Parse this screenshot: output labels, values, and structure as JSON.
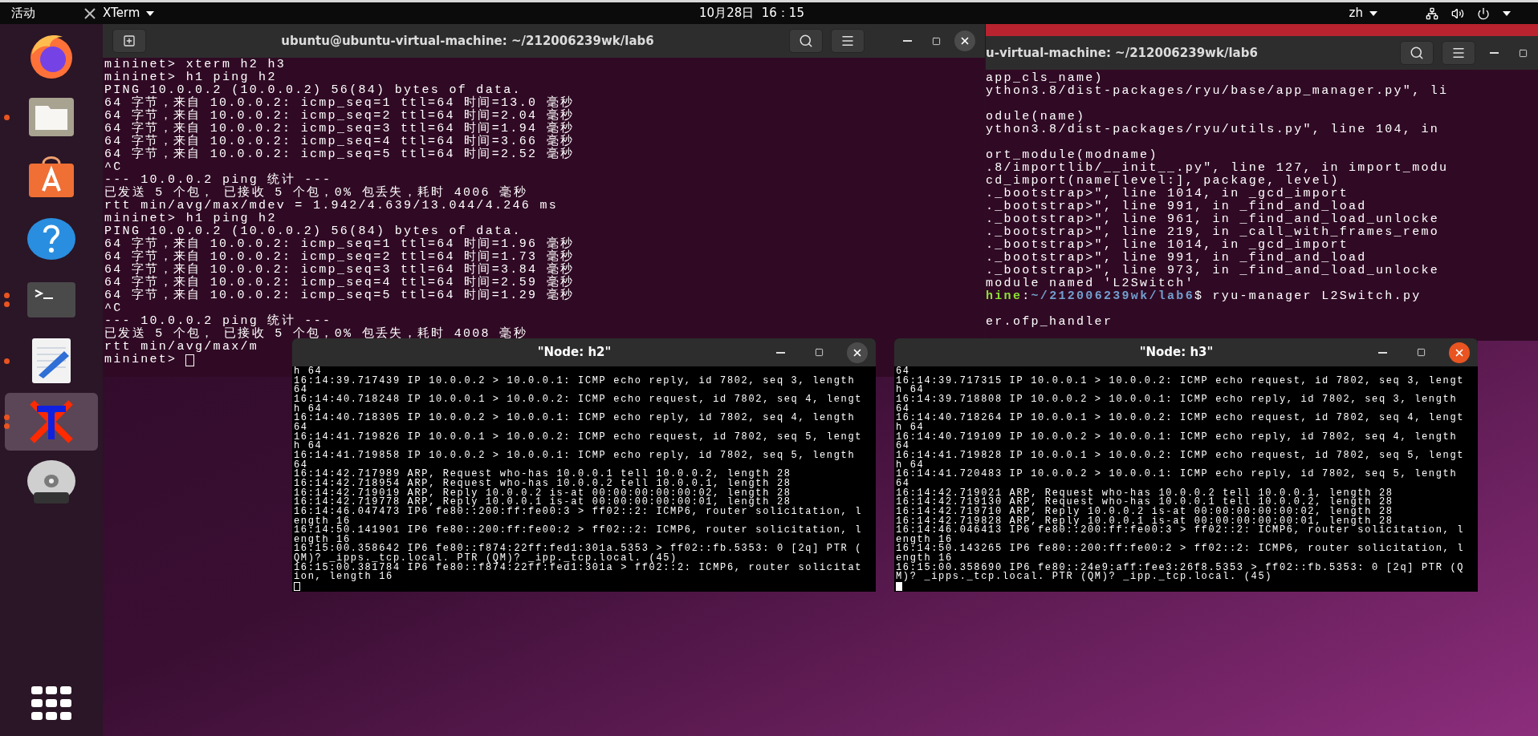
{
  "top_bar": {
    "activities": "活动",
    "app_menu": "XTerm",
    "clock": "10月28日  16：15",
    "language": "zh"
  },
  "dock": {
    "items": [
      {
        "kind": "browser",
        "selected": false,
        "running": false
      },
      {
        "kind": "files",
        "selected": false,
        "running": true,
        "multiple": false
      },
      {
        "kind": "software",
        "selected": false,
        "running": false
      },
      {
        "kind": "help",
        "selected": false,
        "running": false
      },
      {
        "kind": "terminal",
        "selected": false,
        "running": true,
        "multiple": true
      },
      {
        "kind": "editor",
        "selected": false,
        "running": true,
        "multiple": false
      },
      {
        "kind": "xterm",
        "selected": true,
        "running": true,
        "multiple": true
      },
      {
        "kind": "dvd",
        "selected": false,
        "running": false
      }
    ]
  },
  "main_terminal": {
    "title": "ubuntu@ubuntu-virtual-machine: ~/212006239wk/lab6",
    "focused": false,
    "lines": [
      "mininet> xterm h2 h3",
      "mininet> h1 ping h2",
      "PING 10.0.0.2 (10.0.0.2) 56(84) bytes of data.",
      "64 字节，来自 10.0.0.2: icmp_seq=1 ttl=64 时间=13.0 毫秒",
      "64 字节，来自 10.0.0.2: icmp_seq=2 ttl=64 时间=2.04 毫秒",
      "64 字节，来自 10.0.0.2: icmp_seq=3 ttl=64 时间=1.94 毫秒",
      "64 字节，来自 10.0.0.2: icmp_seq=4 ttl=64 时间=3.66 毫秒",
      "64 字节，来自 10.0.0.2: icmp_seq=5 ttl=64 时间=2.52 毫秒",
      "^C",
      "--- 10.0.0.2 ping 统计 ---",
      "已发送 5 个包， 已接收 5 个包，0% 包丢失，耗时 4006 毫秒",
      "rtt min/avg/max/mdev = 1.942/4.639/13.044/4.246 ms",
      "mininet> h1 ping h2",
      "PING 10.0.0.2 (10.0.0.2) 56(84) bytes of data.",
      "64 字节，来自 10.0.0.2: icmp_seq=1 ttl=64 时间=1.96 毫秒",
      "64 字节，来自 10.0.0.2: icmp_seq=2 ttl=64 时间=1.73 毫秒",
      "64 字节，来自 10.0.0.2: icmp_seq=3 ttl=64 时间=3.84 毫秒",
      "64 字节，来自 10.0.0.2: icmp_seq=4 ttl=64 时间=2.59 毫秒",
      "64 字节，来自 10.0.0.2: icmp_seq=5 ttl=64 时间=1.29 毫秒",
      "^C",
      "--- 10.0.0.2 ping 统计 ---",
      "已发送 5 个包， 已接收 5 个包，0% 包丢失，耗时 4008 毫秒",
      "rtt min/avg/max/m"
    ],
    "prompt": "mininet>"
  },
  "background_terminal": {
    "title": "u-virtual-machine: ~/212006239wk/lab6",
    "blocks": [
      {
        "lines": [
          "app_cls_name)",
          "ython3.8/dist-packages/ryu/base/app_manager.py\", li"
        ]
      },
      {
        "lines": [
          "odule(name)",
          "ython3.8/dist-packages/ryu/utils.py\", line 104, in"
        ]
      },
      {
        "lines": [
          "ort_module(modname)",
          ".8/importlib/__init__.py\", line 127, in import_modu",
          "cd_import(name[level:], package, level)",
          "._bootstrap>\", line 1014, in _gcd_import",
          "._bootstrap>\", line 991, in _find_and_load",
          "._bootstrap>\", line 961, in _find_and_load_unlocke",
          "._bootstrap>\", line 219, in _call_with_frames_remo",
          "._bootstrap>\", line 1014, in _gcd_import",
          "._bootstrap>\", line 991, in _find_and_load",
          "._bootstrap>\", line 973, in _find_and_load_unlocke",
          "module named 'L2Switch'"
        ],
        "prompt": {
          "host": "hine",
          "separator": ":",
          "path": "~/212006239wk/lab6",
          "command": "$ ryu-manager L2Switch.py"
        }
      },
      {
        "lines": [
          "er.ofp_handler"
        ]
      }
    ]
  },
  "nodes": [
    {
      "title": "\"Node: h2\"",
      "focused": false,
      "lines": [
        "h 64",
        "16:14:39.717439 IP 10.0.0.2 > 10.0.0.1: ICMP echo reply, id 7802, seq 3, length",
        "64",
        "16:14:40.718248 IP 10.0.0.1 > 10.0.0.2: ICMP echo request, id 7802, seq 4, lengt",
        "h 64",
        "16:14:40.718305 IP 10.0.0.2 > 10.0.0.1: ICMP echo reply, id 7802, seq 4, length",
        "64",
        "16:14:41.719826 IP 10.0.0.1 > 10.0.0.2: ICMP echo request, id 7802, seq 5, lengt",
        "h 64",
        "16:14:41.719858 IP 10.0.0.2 > 10.0.0.1: ICMP echo reply, id 7802, seq 5, length",
        "64",
        "16:14:42.717989 ARP, Request who-has 10.0.0.1 tell 10.0.0.2, length 28",
        "16:14:42.718954 ARP, Request who-has 10.0.0.2 tell 10.0.0.1, length 28",
        "16:14:42.719019 ARP, Reply 10.0.0.2 is-at 00:00:00:00:00:02, length 28",
        "16:14:42.719778 ARP, Reply 10.0.0.1 is-at 00:00:00:00:00:01, length 28",
        "16:14:46.047473 IP6 fe80::200:ff:fe00:3 > ff02::2: ICMP6, router solicitation, l",
        "ength 16",
        "16:14:50.141901 IP6 fe80::200:ff:fe00:2 > ff02::2: ICMP6, router solicitation, l",
        "ength 16",
        "16:15:00.358642 IP6 fe80::f874:22ff:fed1:301a.5353 > ff02::fb.5353: 0 [2q] PTR (",
        "QM)? _ipps._tcp.local. PTR (QM)? _ipp._tcp.local. (45)",
        "16:15:00.381784 IP6 fe80::f874:22ff:fed1:301a > ff02::2: ICMP6, router solicitat",
        "ion, length 16"
      ]
    },
    {
      "title": "\"Node: h3\"",
      "focused": true,
      "lines": [
        "64",
        "16:14:39.717315 IP 10.0.0.1 > 10.0.0.2: ICMP echo request, id 7802, seq 3, lengt",
        "h 64",
        "16:14:39.718808 IP 10.0.0.2 > 10.0.0.1: ICMP echo reply, id 7802, seq 3, length",
        "64",
        "16:14:40.718264 IP 10.0.0.1 > 10.0.0.2: ICMP echo request, id 7802, seq 4, lengt",
        "h 64",
        "16:14:40.719109 IP 10.0.0.2 > 10.0.0.1: ICMP echo reply, id 7802, seq 4, length",
        "64",
        "16:14:41.719828 IP 10.0.0.1 > 10.0.0.2: ICMP echo request, id 7802, seq 5, lengt",
        "h 64",
        "16:14:41.720483 IP 10.0.0.2 > 10.0.0.1: ICMP echo reply, id 7802, seq 5, length",
        "64",
        "16:14:42.719021 ARP, Request who-has 10.0.0.2 tell 10.0.0.1, length 28",
        "16:14:42.719130 ARP, Request who-has 10.0.0.1 tell 10.0.0.2, length 28",
        "16:14:42.719710 ARP, Reply 10.0.0.2 is-at 00:00:00:00:00:02, length 28",
        "16:14:42.719828 ARP, Reply 10.0.0.1 is-at 00:00:00:00:00:01, length 28",
        "16:14:46.046413 IP6 fe80::200:ff:fe00:3 > ff02::2: ICMP6, router solicitation, l",
        "ength 16",
        "16:14:50.143265 IP6 fe80::200:ff:fe00:2 > ff02::2: ICMP6, router solicitation, l",
        "ength 16",
        "16:15:00.358690 IP6 fe80::24e9:aff:fee3:26f8.5353 > ff02::fb.5353: 0 [2q] PTR (Q",
        "M)? _ipps._tcp.local. PTR (QM)? _ipp._tcp.local. (45)"
      ]
    }
  ]
}
